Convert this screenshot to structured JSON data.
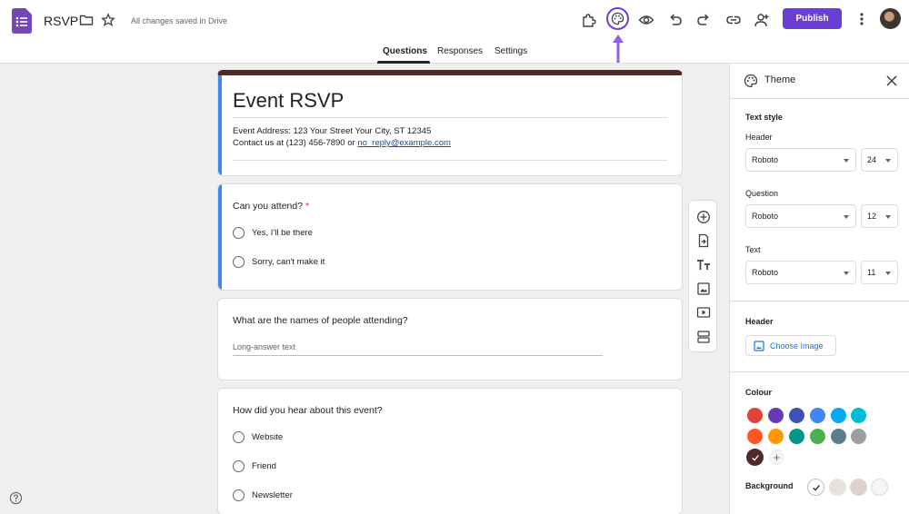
{
  "app": {
    "doc_title": "RSVP",
    "save_status": "All changes saved in Drive",
    "publish_label": "Publish"
  },
  "tabs": [
    "Questions",
    "Responses",
    "Settings"
  ],
  "form": {
    "title": "Event RSVP",
    "address": "Event Address: 123 Your Street Your City, ST 12345",
    "contact_prefix": "Contact us at (123) 456-7890 or ",
    "contact_email": "no_reply@example.com"
  },
  "questions": [
    {
      "title": "Can you attend?",
      "required_mark": "*",
      "options": [
        "Yes,  I'll be there",
        "Sorry, can't make it"
      ]
    },
    {
      "title": "What are the names of people attending?",
      "placeholder": "Long-answer text"
    },
    {
      "title": "How did you hear about this event?",
      "options": [
        "Website",
        "Friend",
        "Newsletter"
      ]
    }
  ],
  "theme_panel": {
    "title": "Theme",
    "text_style_label": "Text style",
    "header": {
      "label": "Header",
      "font": "Roboto",
      "size": "24"
    },
    "question": {
      "label": "Question",
      "font": "Roboto",
      "size": "12"
    },
    "text": {
      "label": "Text",
      "font": "Roboto",
      "size": "11"
    },
    "header_image_label": "Header",
    "choose_image_label": "Choose Image",
    "colour_label": "Colour",
    "colours": [
      "#db4437",
      "#673ab7",
      "#3f51b5",
      "#4285f4",
      "#03a9f4",
      "#00bcd4",
      "#ff5722",
      "#ff9800",
      "#009688",
      "#4caf50",
      "#607d8b",
      "#9e9e9e",
      "#4e2a28"
    ],
    "background_label": "Background",
    "backgrounds": [
      "#ffffff",
      "#e7e1df",
      "#dcd2cf",
      "#f5f5f5"
    ]
  }
}
